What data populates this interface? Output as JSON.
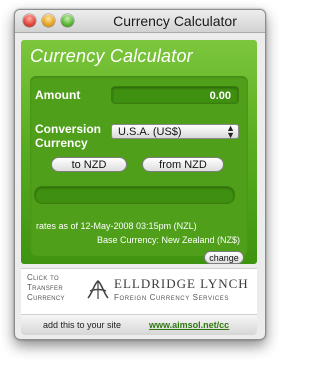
{
  "window": {
    "title": "Currency Calculator"
  },
  "header": {
    "title": "Currency Calculator"
  },
  "form": {
    "amount_label": "Amount",
    "amount_value": "0.00",
    "conversion_label_line1": "Conversion",
    "conversion_label_line2": "Currency",
    "currency_selected": "U.S.A. (US$)",
    "to_button": "to NZD",
    "from_button": "from NZD"
  },
  "info": {
    "rates_text": "rates as of 12-May-2008 03:15pm (NZL)",
    "base_currency_text": "Base Currency: New Zealand (NZ$)",
    "change_button": "change"
  },
  "banner": {
    "click_line1": "Click to",
    "click_line2": "Transfer",
    "click_line3": "Currency",
    "company_name": "ELLDRIDGE LYNCH",
    "company_tagline": "Foreign Currency Services"
  },
  "footer": {
    "prefix": "add this to your site",
    "link": "www.aimsol.net/cc"
  },
  "colors": {
    "accent_green": "#5aad20",
    "panel_green": "#4f9f1a"
  }
}
